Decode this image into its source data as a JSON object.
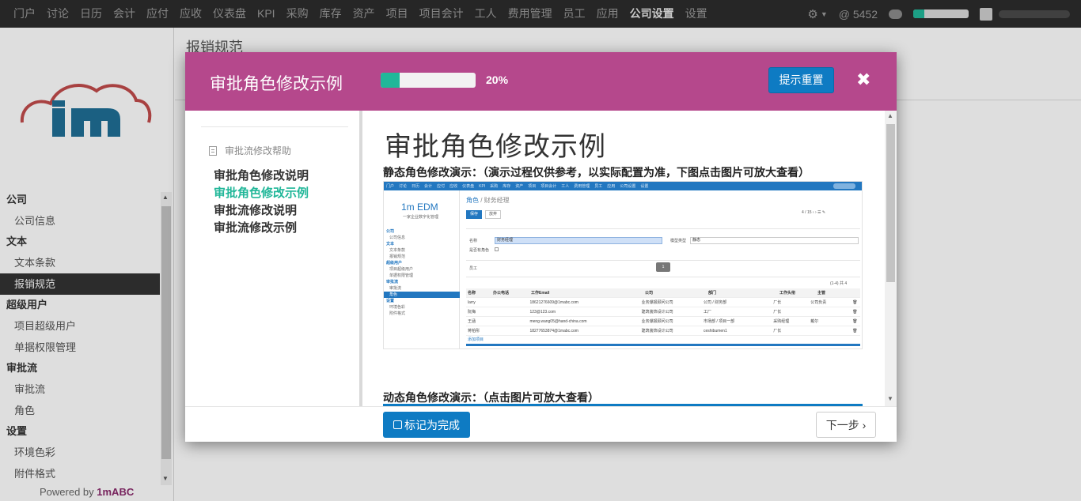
{
  "topnav": {
    "items": [
      "门户",
      "讨论",
      "日历",
      "会计",
      "应付",
      "应收",
      "仪表盘",
      "KPI",
      "采购",
      "库存",
      "资产",
      "项目",
      "项目会计",
      "工人",
      "费用管理",
      "员工",
      "应用",
      "公司设置",
      "设置"
    ],
    "active_index": 17,
    "mention_count": "@ 5452",
    "progress_fraction": 0.2,
    "icons": [
      "gear-icon",
      "chevron-down-icon",
      "chat-icon",
      "avatar"
    ]
  },
  "sidebar": {
    "groups": [
      {
        "title": "公司",
        "items": [
          "公司信息"
        ]
      },
      {
        "title": "文本",
        "items": [
          "文本条款",
          "报销规范"
        ]
      },
      {
        "title": "超级用户",
        "items": [
          "项目超级用户",
          "单据权限管理"
        ]
      },
      {
        "title": "审批流",
        "items": [
          "审批流",
          "角色"
        ]
      },
      {
        "title": "设置",
        "items": [
          "环境色彩",
          "附件格式"
        ]
      }
    ],
    "active_item": "报销规范",
    "powered_prefix": "Powered by ",
    "powered_brand": "1mABC"
  },
  "main": {
    "page_title": "报销规范"
  },
  "modal": {
    "title": "审批角色修改示例",
    "progress_percent": "20%",
    "progress_fraction": 0.2,
    "reset_label": "提示重置",
    "close_icon": "✖",
    "help_title": "审批流修改帮助",
    "steps": [
      "审批角色修改说明",
      "审批角色修改示例",
      "审批流修改说明",
      "审批流修改示例"
    ],
    "current_step_index": 1,
    "content": {
      "heading": "审批角色修改示例",
      "static_caption": "静态角色修改演示：（演示过程仅供参考，以实际配置为准，下图点击图片可放大查看）",
      "dynamic_caption": "动态角色修改演示：（点击图片可放大查看）"
    },
    "done_label": "标记为完成",
    "next_label": "下一步 ›"
  },
  "screenshot": {
    "nav": [
      "门户",
      "讨论",
      "日历",
      "会计",
      "应付",
      "应收",
      "仪表盘",
      "KPI",
      "采购",
      "库存",
      "资产",
      "项目",
      "项目会计",
      "工人",
      "费用管理",
      "员工",
      "应用",
      "公司设置",
      "设置"
    ],
    "logo": "1m EDM",
    "slogan": "一家企业数字化管理",
    "menu": [
      {
        "type": "head",
        "text": "公司"
      },
      {
        "type": "item",
        "text": "公司信息"
      },
      {
        "type": "head",
        "text": "文本"
      },
      {
        "type": "item",
        "text": "文本条款"
      },
      {
        "type": "item",
        "text": "报销规范"
      },
      {
        "type": "head",
        "text": "超级用户"
      },
      {
        "type": "item",
        "text": "项目超级用户"
      },
      {
        "type": "item",
        "text": "单据权限管理"
      },
      {
        "type": "head",
        "text": "审批流"
      },
      {
        "type": "item",
        "text": "审批流"
      },
      {
        "type": "item",
        "text": "角色",
        "active": true
      },
      {
        "type": "head",
        "text": "设置"
      },
      {
        "type": "item",
        "text": "环境色彩"
      },
      {
        "type": "item",
        "text": "附件格式"
      }
    ],
    "breadcrumb_root": "角色",
    "breadcrumb_current": " / 财务经理",
    "save_label": "保存",
    "cancel_label": "放弃",
    "pager": "4 / 15",
    "name_label": "名称",
    "name_value": "财务经理",
    "type_label": "模型类型",
    "type_value": "静态",
    "check_label": "是否有角色",
    "tab_label": "员工",
    "tooltip": "1",
    "count": "(1-4) 共 4",
    "columns": [
      "名称",
      "办公电话",
      "工作Email",
      "公司",
      "部门",
      "工作头衔",
      "主管"
    ],
    "rows": [
      [
        "larry",
        "",
        "18621276609@1mabc.com",
        "业务爆报顾问公司",
        "公司 / 财务部",
        "厂长",
        "公司负责"
      ],
      [
        "阮梅",
        "",
        "123@123.com",
        "建筑装饰设计公司",
        "工厂",
        "厂长",
        ""
      ],
      [
        "王涵",
        "",
        "meng.wang05@hand-china.com",
        "业务爆报顾问公司",
        "市场部 / 项目一部",
        "采购经理",
        "戴尔"
      ],
      [
        "蒋柏彤",
        "",
        "18277653874@1mabc.com",
        "建筑装饰设计公司",
        "ceshibumen1",
        "厂长",
        ""
      ]
    ],
    "add_label": "添加项目"
  }
}
